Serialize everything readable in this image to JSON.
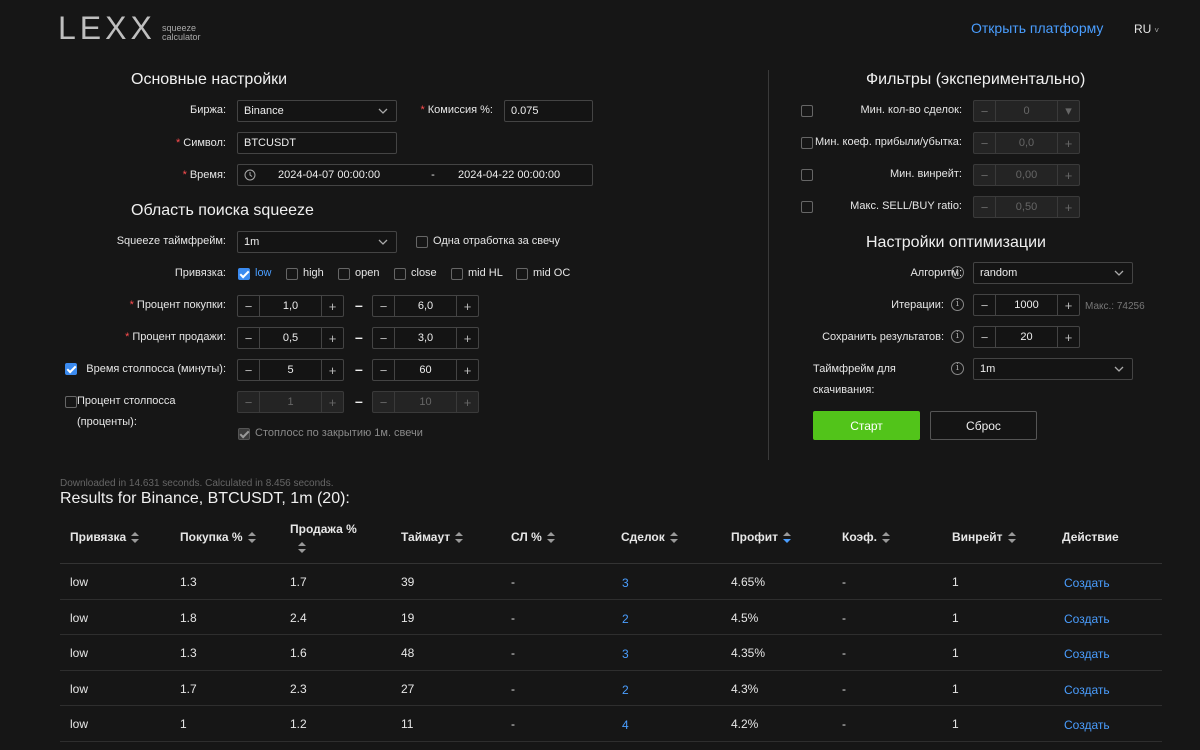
{
  "brand": {
    "logo_text": "LEXX",
    "sub_line1": "squeeze",
    "sub_line2": "calculator"
  },
  "header": {
    "open_platform": "Открыть платформу",
    "lang": "RU"
  },
  "main_settings": {
    "title": "Основные настройки",
    "exchange_label": "Биржа:",
    "exchange_value": "Binance",
    "commission_label": "Комиссия %:",
    "commission_value": "0.075",
    "symbol_label": "Символ:",
    "symbol_value": "BTCUSDT",
    "time_label": "Время:",
    "time_from": "2024-04-07 00:00:00",
    "time_sep": "-",
    "time_to": "2024-04-22 00:00:00"
  },
  "squeeze_area": {
    "title": "Область поиска squeeze",
    "timeframe_label": "Squeeze таймфрейм:",
    "timeframe_value": "1m",
    "one_per_candle": "Одна отработка за свечу",
    "binding_label": "Привязка:",
    "bindings": [
      {
        "label": "low",
        "checked": true
      },
      {
        "label": "high",
        "checked": false
      },
      {
        "label": "open",
        "checked": false
      },
      {
        "label": "close",
        "checked": false
      },
      {
        "label": "mid HL",
        "checked": false
      },
      {
        "label": "mid OC",
        "checked": false
      }
    ],
    "buy_label": "Процент покупки:",
    "buy_from": "1,0",
    "buy_to": "6,0",
    "sell_label": "Процент продажи:",
    "sell_from": "0,5",
    "sell_to": "3,0",
    "stop_time_label": "Время столпосса (минуты):",
    "stop_time_from": "5",
    "stop_time_to": "60",
    "stop_pct_label_1": "Процент столпосса",
    "stop_pct_label_2": "(проценты):",
    "stop_pct_from": "1",
    "stop_pct_to": "10",
    "stop_on_close": "Стоплосс по закрытию 1м. свечи",
    "range_dash": "–"
  },
  "filters": {
    "title": "Фильтры (экспериментально)",
    "items": [
      {
        "label": "Мин. кол-во сделок:",
        "value": "0"
      },
      {
        "label": "Мин. коеф. прибыли/убытка:",
        "value": "0,0"
      },
      {
        "label": "Мин. винрейт:",
        "value": "0,00"
      },
      {
        "label": "Макс. SELL/BUY ratio:",
        "value": "0,50"
      }
    ]
  },
  "optimization": {
    "title": "Настройки оптимизации",
    "algorithm_label": "Алгоритм:",
    "algorithm_value": "random",
    "iterations_label": "Итерации:",
    "iterations_value": "1000",
    "iterations_max": "Макс.: 74256",
    "save_label": "Сохранить результатов:",
    "save_value": "20",
    "download_tf_label_1": "Таймфрейм для",
    "download_tf_label_2": "скачивания:",
    "download_tf_value": "1m",
    "start": "Старт",
    "reset": "Сброс",
    "info_glyph": "i"
  },
  "results": {
    "timing": "Downloaded in 14.631 seconds. Calculated in 8.456 seconds.",
    "title": "Results for Binance, BTCUSDT, 1m (20):",
    "columns": [
      "Привязка",
      "Покупка %",
      "Продажа %",
      "Таймаут",
      "СЛ %",
      "Сделок",
      "Профит",
      "Коэф.",
      "Винрейт",
      "Действие"
    ],
    "rows": [
      {
        "binding": "low",
        "buy": "1.3",
        "sell": "1.7",
        "timeout": "39",
        "sl": "-",
        "deals": "3",
        "profit": "4.65%",
        "coef": "-",
        "winrate": "1",
        "action": "Создать"
      },
      {
        "binding": "low",
        "buy": "1.8",
        "sell": "2.4",
        "timeout": "19",
        "sl": "-",
        "deals": "2",
        "profit": "4.5%",
        "coef": "-",
        "winrate": "1",
        "action": "Создать"
      },
      {
        "binding": "low",
        "buy": "1.3",
        "sell": "1.6",
        "timeout": "48",
        "sl": "-",
        "deals": "3",
        "profit": "4.35%",
        "coef": "-",
        "winrate": "1",
        "action": "Создать"
      },
      {
        "binding": "low",
        "buy": "1.7",
        "sell": "2.3",
        "timeout": "27",
        "sl": "-",
        "deals": "2",
        "profit": "4.3%",
        "coef": "-",
        "winrate": "1",
        "action": "Создать"
      },
      {
        "binding": "low",
        "buy": "1",
        "sell": "1.2",
        "timeout": "11",
        "sl": "-",
        "deals": "4",
        "profit": "4.2%",
        "coef": "-",
        "winrate": "1",
        "action": "Создать"
      }
    ]
  }
}
